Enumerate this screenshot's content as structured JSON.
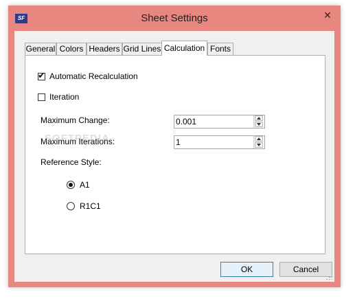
{
  "window": {
    "title": "Sheet Settings",
    "icon_text": "SF",
    "close_symbol": "✕",
    "frame_color": "#e8877f"
  },
  "tabs": [
    {
      "label": "General"
    },
    {
      "label": "Colors"
    },
    {
      "label": "Headers"
    },
    {
      "label": "Grid Lines"
    },
    {
      "label": "Calculation",
      "active": true
    },
    {
      "label": "Fonts"
    }
  ],
  "calculation": {
    "auto_recalc": {
      "label": "Automatic Recalculation",
      "checked": true,
      "mark": "✔"
    },
    "iteration": {
      "label": "Iteration",
      "checked": false
    },
    "max_change": {
      "label": "Maximum Change:",
      "value": "0.001"
    },
    "max_iterations": {
      "label": "Maximum Iterations:",
      "value": "1"
    },
    "reference_style": {
      "label": "Reference Style:",
      "options": [
        {
          "label": "A1",
          "selected": true
        },
        {
          "label": "R1C1",
          "selected": false
        }
      ]
    }
  },
  "buttons": {
    "ok": "OK",
    "cancel": "Cancel"
  },
  "watermark": "SOFTPEDIA"
}
